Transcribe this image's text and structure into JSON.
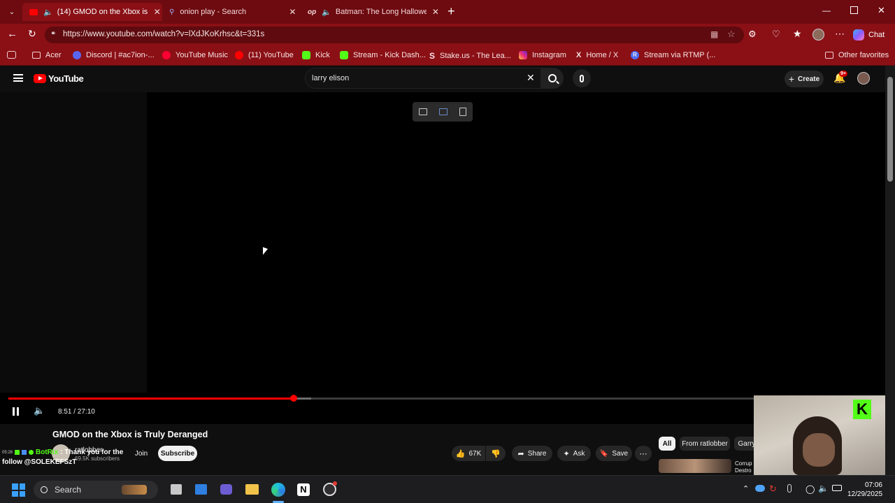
{
  "browser": {
    "tabs": [
      {
        "title": "(14) GMOD on the Xbox is Tru",
        "active": true,
        "icon": "youtube-icon",
        "audio": true
      },
      {
        "title": "onion play - Search",
        "active": false,
        "icon": "search-icon"
      },
      {
        "title": "Batman: The Long Halloween",
        "active": false,
        "icon": "op-icon",
        "icon_text": "op",
        "audio": true
      }
    ],
    "address": "https://www.youtube.com/watch?v=lXdJKoKrhsc&t=331s",
    "chat_label": "Chat",
    "favorites": [
      {
        "label": "Acer",
        "icon": "folder-icon"
      },
      {
        "label": "Discord | #ac7ion-...",
        "icon": "discord-icon",
        "color": "#5865f2"
      },
      {
        "label": "YouTube Music",
        "icon": "youtube-music-icon",
        "color": "#ff0033"
      },
      {
        "label": "(11) YouTube",
        "icon": "youtube-icon",
        "color": "#ff0000"
      },
      {
        "label": "Kick",
        "icon": "kick-icon",
        "color": "#53fc18"
      },
      {
        "label": "Stream - Kick Dash...",
        "icon": "kick-icon",
        "color": "#53fc18"
      },
      {
        "label": "Stake.us - The Lea...",
        "icon": "stake-icon",
        "icon_text": "S"
      },
      {
        "label": "Instagram",
        "icon": "instagram-icon",
        "color": "#e1306c"
      },
      {
        "label": "Home / X",
        "icon": "x-icon",
        "icon_text": "X"
      },
      {
        "label": "Stream via RTMP (...",
        "icon": "rtmp-icon",
        "icon_text": "R",
        "color": "#4a6cf7"
      }
    ],
    "other_favorites": "Other favorites"
  },
  "youtube": {
    "logo_text": "YouTube",
    "search_value": "larry elison",
    "create_label": "Create",
    "notifications_badge": "9+",
    "player": {
      "time": "8:51 / 27:10",
      "played_fraction": 0.325,
      "loaded_fraction": 0.345
    },
    "video_title": "GMOD on the Xbox is Truly Deranged",
    "channel_name": "ratlobber",
    "subscribers": "69.5K subscribers",
    "join_label": "Join",
    "subscribe_label": "Subscribe",
    "likes": "67K",
    "share_label": "Share",
    "ask_label": "Ask",
    "save_label": "Save",
    "chips": [
      "All",
      "From ratlobber",
      "Garry"
    ],
    "rec_title_1": "Corrup",
    "rec_title_2": "Destro"
  },
  "overlay": {
    "chat_time": "05:28",
    "chat_user": "BotRix",
    "chat_message_1": ": Thank you for the",
    "chat_message_2": "follow @SOLEKEFSzT"
  },
  "taskbar": {
    "search_label": "Search",
    "time": "07:06",
    "date": "12/29/2025"
  },
  "colors": {
    "browser_frame": "#8a1016",
    "youtube_red": "#ff0000",
    "kick_green": "#53fc18"
  }
}
